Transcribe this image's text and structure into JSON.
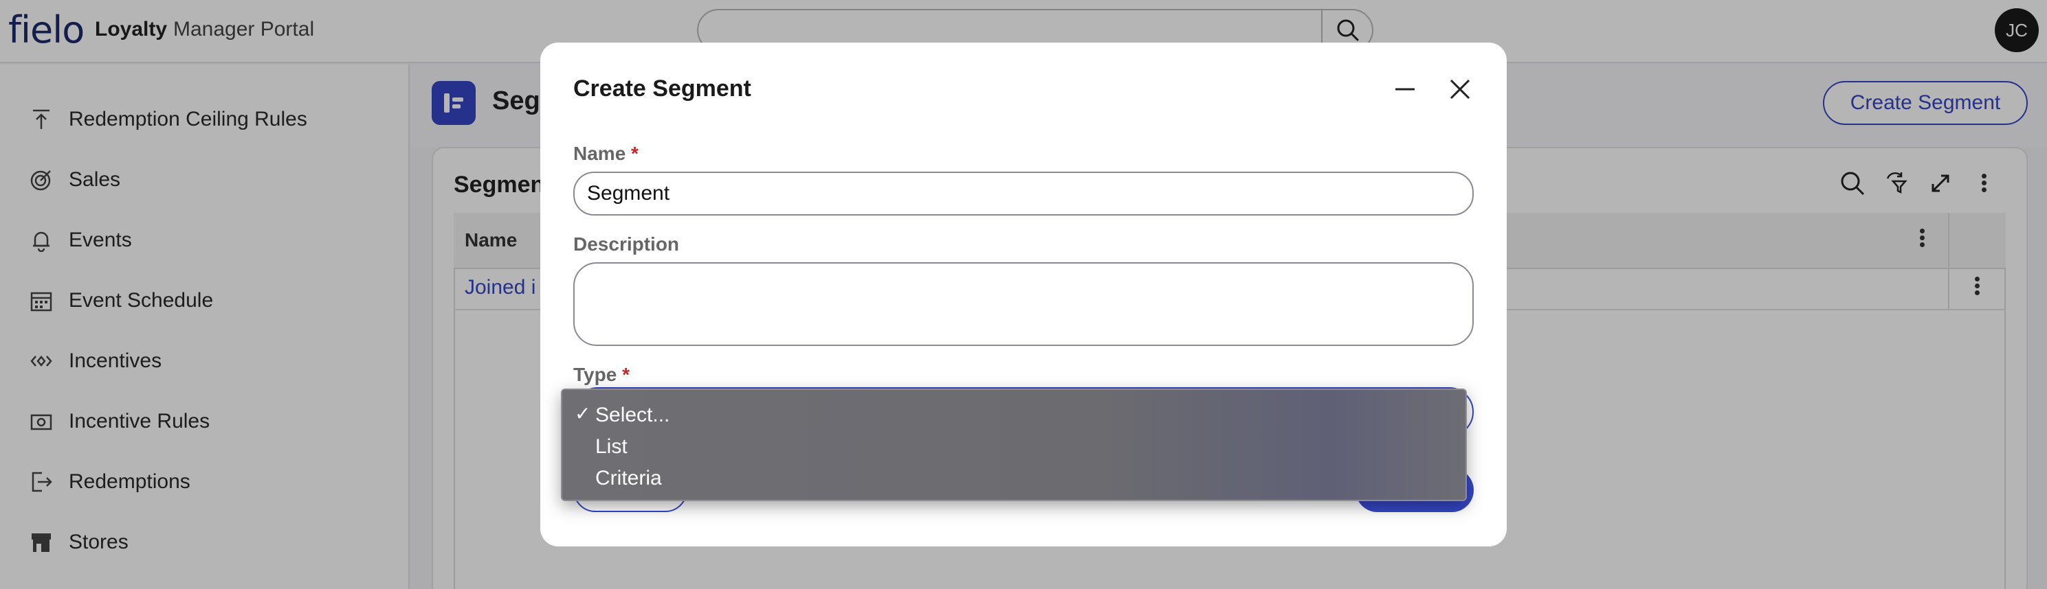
{
  "header": {
    "logo": "fielo",
    "app_name": "Loyalty",
    "app_sub": "Manager Portal",
    "search": {
      "value": "",
      "icon": "search-icon"
    },
    "avatar_initials": "JC"
  },
  "sidebar": {
    "items": [
      {
        "label": "Redemption Ceiling Rules",
        "icon": "arrow-up-bar-icon"
      },
      {
        "label": "Sales",
        "icon": "target-icon"
      },
      {
        "label": "Events",
        "icon": "bell-icon"
      },
      {
        "label": "Event Schedule",
        "icon": "calendar-icon"
      },
      {
        "label": "Incentives",
        "icon": "code-diamond-icon"
      },
      {
        "label": "Incentive Rules",
        "icon": "ticket-icon"
      },
      {
        "label": "Redemptions",
        "icon": "exit-icon"
      },
      {
        "label": "Stores",
        "icon": "store-icon"
      }
    ]
  },
  "page": {
    "title": "Segm",
    "create_button": "Create Segment",
    "card_title": "Segmen",
    "table": {
      "columns": [
        "Name"
      ],
      "rows": [
        {
          "name": "Joined i"
        }
      ]
    }
  },
  "modal": {
    "title": "Create Segment",
    "fields": {
      "name": {
        "label": "Name",
        "required_mark": "*",
        "value": "Segment"
      },
      "description": {
        "label": "Description",
        "value": ""
      },
      "type": {
        "label": "Type",
        "required_mark": "*",
        "value": "Select..."
      }
    },
    "dropdown": {
      "options": [
        "Select...",
        "List",
        "Criteria"
      ],
      "selected_index": 0,
      "check_mark": "✓"
    }
  },
  "colors": {
    "accent": "#3546c4",
    "required": "#c62828",
    "overlay": "rgba(0,0,0,0.29)"
  }
}
